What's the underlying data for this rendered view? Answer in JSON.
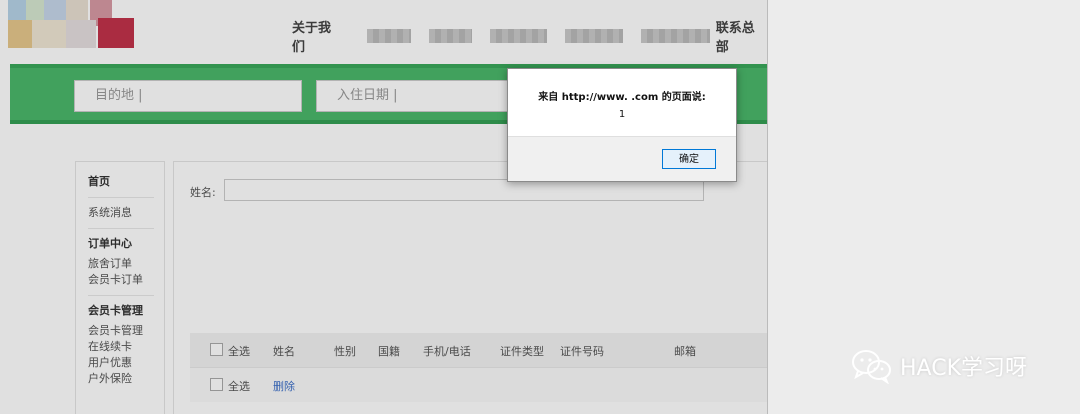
{
  "nav": {
    "items": [
      "关于我们",
      "联系总部"
    ]
  },
  "search": {
    "destination_placeholder": "目的地  |",
    "checkin_placeholder": "入住日期  |"
  },
  "sidebar": {
    "items": [
      {
        "label": "首页",
        "kind": "head"
      },
      {
        "label": "系统消息",
        "kind": "item"
      },
      {
        "label": "订单中心",
        "kind": "head"
      },
      {
        "label": "旅舍订单",
        "kind": "item"
      },
      {
        "label": "会员卡订单",
        "kind": "item"
      },
      {
        "label": "会员卡管理",
        "kind": "head"
      },
      {
        "label": "会员卡管理",
        "kind": "item"
      },
      {
        "label": "在线续卡",
        "kind": "item"
      },
      {
        "label": "用户优惠",
        "kind": "item"
      },
      {
        "label": "户外保险",
        "kind": "item"
      }
    ]
  },
  "form": {
    "name_label": "姓名:"
  },
  "table": {
    "headers": [
      "全选",
      "姓名",
      "性别",
      "国籍",
      "手机/电话",
      "证件类型",
      "证件号码",
      "邮箱"
    ],
    "footer_select_all": "全选",
    "delete_label": "删除"
  },
  "dialog": {
    "title": "来自 http://www.          .com 的页面说:",
    "message": "1",
    "ok_label": "确定"
  },
  "watermark": {
    "text": "HACK学习呀",
    "icon": "wechat-icon"
  }
}
